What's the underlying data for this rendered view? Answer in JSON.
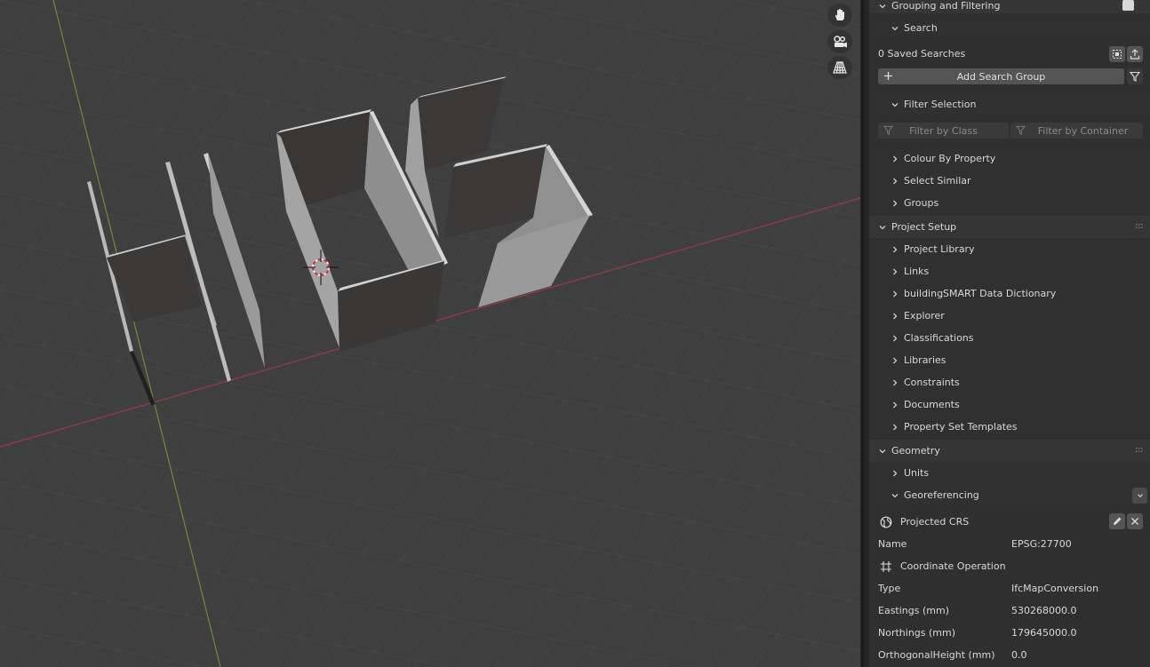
{
  "viewport": {
    "gizmo_icons": [
      "hand-pan-icon",
      "camera-icon",
      "perspective-grid-icon"
    ]
  },
  "panel": {
    "grouping_title": "Grouping and Filtering",
    "search_title": "Search",
    "saved_searches": "0 Saved Searches",
    "add_search_group": "Add Search Group",
    "filter_selection_title": "Filter Selection",
    "filter_by_class": "Filter by Class",
    "filter_by_container": "Filter by Container",
    "colour_by_property": "Colour By Property",
    "select_similar": "Select Similar",
    "groups": "Groups",
    "project_setup_title": "Project Setup",
    "project_setup_items": [
      "Project Library",
      "Links",
      "buildingSMART Data Dictionary",
      "Explorer",
      "Classifications",
      "Libraries",
      "Constraints",
      "Documents",
      "Property Set Templates"
    ],
    "geometry_title": "Geometry",
    "units": "Units",
    "georeferencing": "Georeferencing",
    "projected_crs": "Projected CRS",
    "name_label": "Name",
    "name_value": "EPSG:27700",
    "coordinate_operation": "Coordinate Operation",
    "type_label": "Type",
    "type_value": "IfcMapConversion",
    "eastings_label": "Eastings (mm)",
    "eastings_value": "530268000.0",
    "northings_label": "Northings (mm)",
    "northings_value": "179645000.0",
    "orthogonal_label": "OrthogonalHeight (mm)",
    "orthogonal_value": "0.0"
  }
}
